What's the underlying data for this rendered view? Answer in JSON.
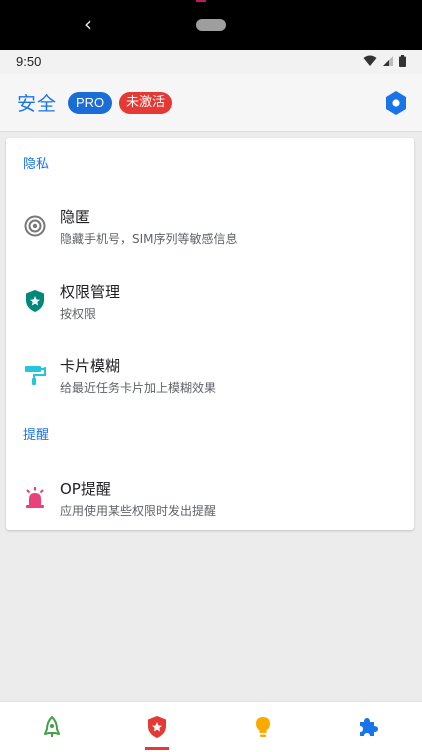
{
  "status_bar": {
    "time": "9:50"
  },
  "app_bar": {
    "title": "安全",
    "pro_badge": "PRO",
    "inactive_badge": "未激活",
    "settings_icon": "hexagon-settings-icon"
  },
  "sections": [
    {
      "header": "隐私",
      "items": [
        {
          "title": "隐匿",
          "subtitle": "隐藏手机号，SIM序列等敏感信息",
          "icon": "target-icon"
        },
        {
          "title": "权限管理",
          "subtitle": "按权限",
          "icon": "shield-star-icon"
        },
        {
          "title": "卡片模糊",
          "subtitle": "给最近任务卡片加上模糊效果",
          "icon": "paint-roller-icon"
        }
      ]
    },
    {
      "header": "提醒",
      "items": [
        {
          "title": "OP提醒",
          "subtitle": "应用使用某些权限时发出提醒",
          "icon": "siren-icon"
        }
      ]
    }
  ],
  "bottom_nav": [
    {
      "icon": "rocket-icon",
      "color": "#43a047",
      "selected": false
    },
    {
      "icon": "shield-star-icon",
      "color": "#e53935",
      "selected": true
    },
    {
      "icon": "lightbulb-icon",
      "color": "#f9ab00",
      "selected": false
    },
    {
      "icon": "puzzle-icon",
      "color": "#1a73e8",
      "selected": false
    }
  ],
  "colors": {
    "accent": "#1a73e8",
    "pro_badge": "#1a6dd6",
    "inactive_badge": "#e53935",
    "shield_teal": "#00897b",
    "roller_cyan": "#26c6da",
    "siren_pink": "#ec407a"
  }
}
